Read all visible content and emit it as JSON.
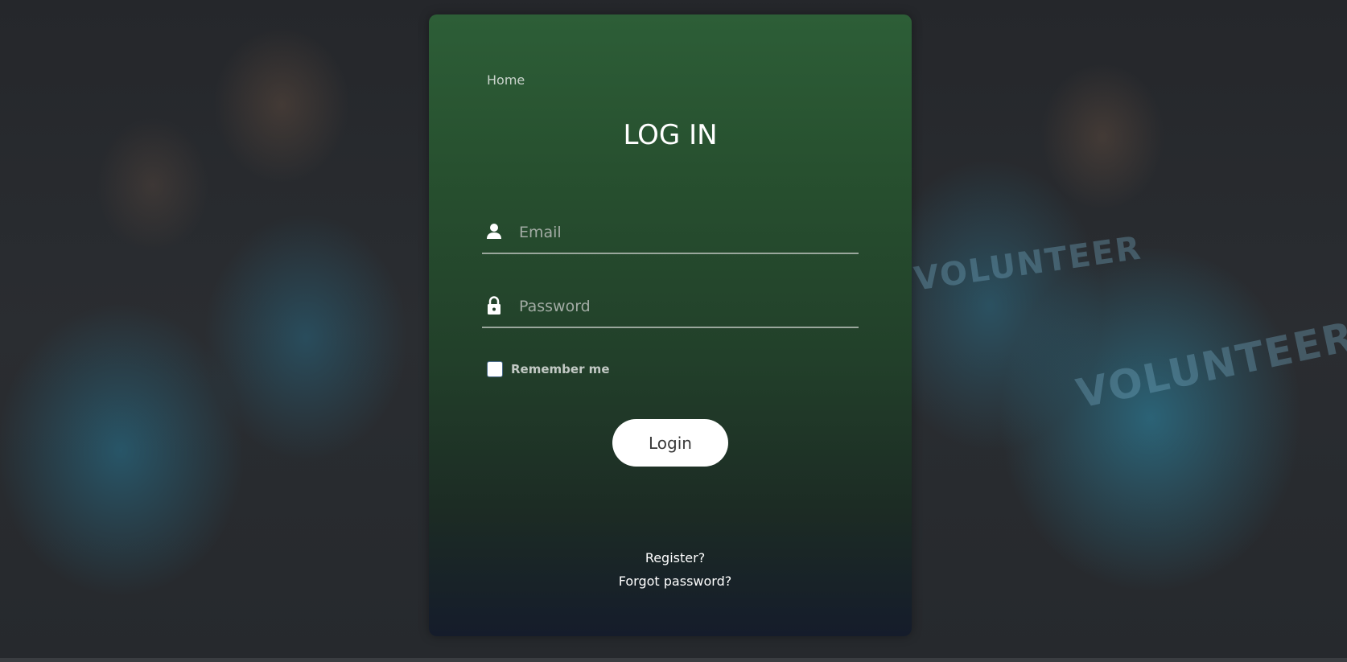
{
  "background": {
    "watermark_texts": [
      "VOLUNTEER",
      "VOLUNTEER"
    ]
  },
  "nav": {
    "home_label": "Home"
  },
  "login_form": {
    "title": "LOG IN",
    "email": {
      "placeholder": "Email",
      "value": "",
      "icon": "user-icon"
    },
    "password": {
      "placeholder": "Password",
      "value": "",
      "icon": "lock-icon"
    },
    "remember_label": "Remember me",
    "remember_checked": false,
    "submit_label": "Login",
    "register_link": "Register?",
    "forgot_link": "Forgot password?"
  },
  "colors": {
    "card_top": "#2d5e37",
    "card_bottom": "#151c2b",
    "text": "#ffffff",
    "muted_text": "#a3aca5",
    "button_bg": "#ffffff"
  }
}
